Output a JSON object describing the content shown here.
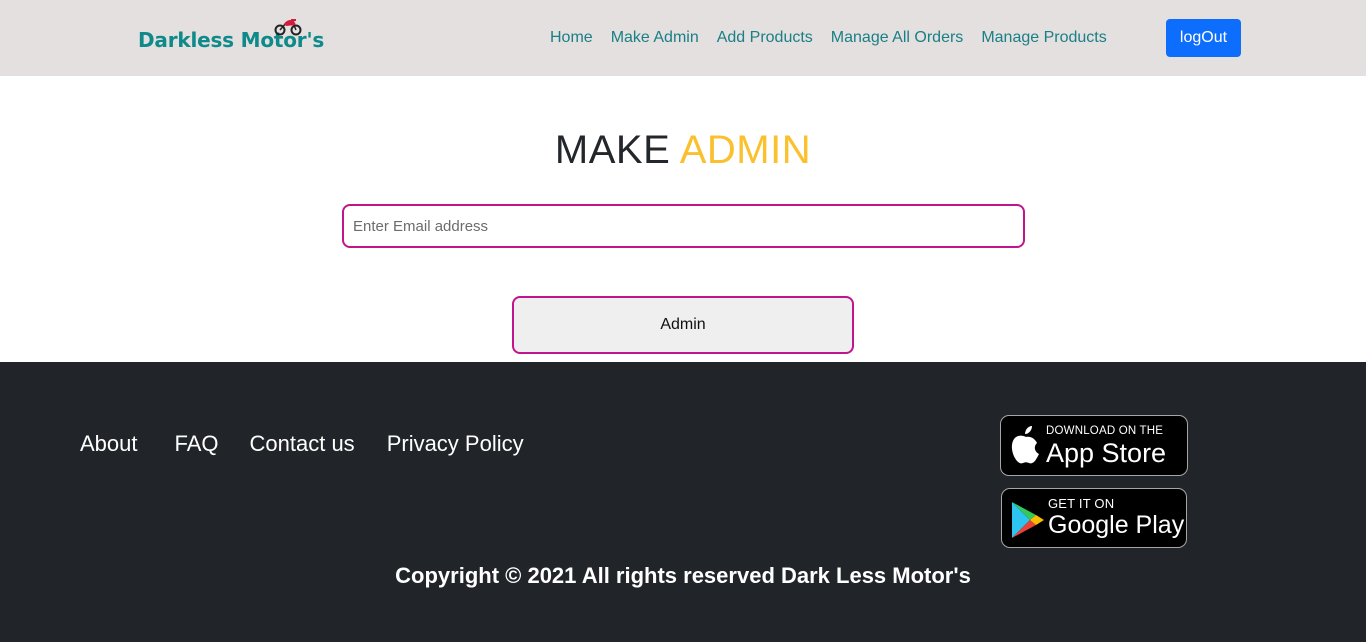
{
  "navbar": {
    "brand": "Darkless Motor's",
    "brand_icon": "motorcycle-icon",
    "links": [
      "Home",
      "Make Admin",
      "Add Products",
      "Manage All Orders",
      "Manage Products"
    ],
    "logout_label": "logOut"
  },
  "main": {
    "title_part1": "MAKE",
    "title_part2": "ADMIN",
    "email_placeholder": "Enter Email address",
    "submit_label": "Admin"
  },
  "footer": {
    "links": [
      "About",
      "FAQ",
      "Contact us",
      "Privacy Policy"
    ],
    "app_store": {
      "small": "DOWNLOAD ON THE",
      "big": "App Store",
      "icon": "apple-icon"
    },
    "google_play": {
      "small": "GET IT ON",
      "big": "Google Play",
      "icon": "play-icon"
    },
    "copyright": "Copyright © 2021 All rights reserved Dark Less Motor's"
  },
  "colors": {
    "nav_bg": "#e3e0df",
    "brand": "#0e8a8a",
    "nav_link": "#1a7f86",
    "logout_bg": "#0d6efd",
    "title_dark": "#23272b",
    "title_accent": "#fbc02d",
    "input_border": "#c0158c",
    "footer_bg": "#212529"
  }
}
